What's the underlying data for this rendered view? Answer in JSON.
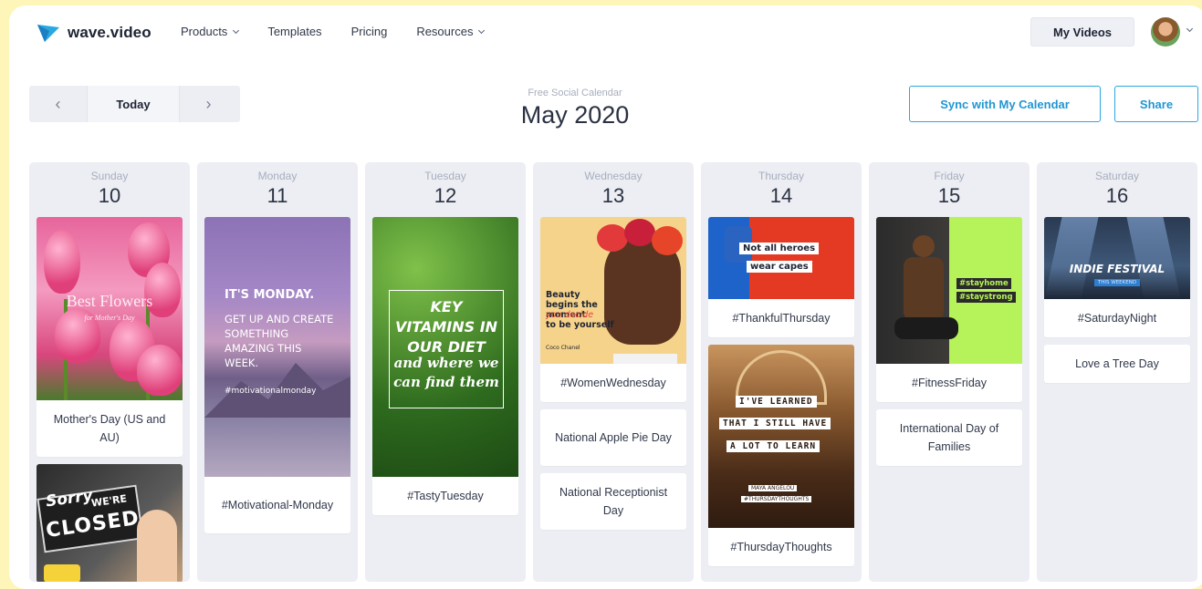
{
  "brand": {
    "name": "wave.video",
    "accent": "#2aa8e0"
  },
  "nav": {
    "products": "Products",
    "templates": "Templates",
    "pricing": "Pricing",
    "resources": "Resources",
    "my_videos": "My Videos"
  },
  "calendar": {
    "today": "Today",
    "prev_icon": "‹",
    "next_icon": "›",
    "subtitle": "Free Social Calendar",
    "title": "May 2020",
    "sync": "Sync with My Calendar",
    "share": "Share"
  },
  "days": [
    {
      "name": "Sunday",
      "num": "10"
    },
    {
      "name": "Monday",
      "num": "11"
    },
    {
      "name": "Tuesday",
      "num": "12"
    },
    {
      "name": "Wednesday",
      "num": "13"
    },
    {
      "name": "Thursday",
      "num": "14"
    },
    {
      "name": "Friday",
      "num": "15"
    },
    {
      "name": "Saturday",
      "num": "16"
    }
  ],
  "events": {
    "sun": {
      "flowers_title": "Best Flowers",
      "flowers_sub": "for Mother's Day",
      "mothers_day": "Mother's Day (US and AU)",
      "closed_1": "Sorry",
      "closed_2": "WE'RE",
      "closed_3": "CLOSED"
    },
    "mon": {
      "line1": "IT'S MONDAY.",
      "line2": "GET UP AND CREATE SOMETHING AMAZING THIS WEEK.",
      "hashtag": "#motivationalmonday",
      "caption": "#Motivational-Monday"
    },
    "tue": {
      "line1": "KEY VITAMINS IN OUR DIET",
      "line2": "and where we can find them",
      "caption": "#TastyTuesday"
    },
    "wed": {
      "quote1": "Beauty begins the moment",
      "quote2": "you decide",
      "quote3": "to be yourself",
      "author": "Coco Chanel",
      "caption1": "#WomenWednesday",
      "caption2": "National Apple Pie Day",
      "caption3": "National Receptionist Day"
    },
    "thu": {
      "heroes1": "Not all heroes",
      "heroes2": "wear capes",
      "caption1": "#ThankfulThursday",
      "lib1": "I'VE LEARNED",
      "lib2": "THAT I STILL HAVE",
      "lib3": "A LOT TO LEARN",
      "lib_author": "MAYA ANGELOU",
      "lib_tag": "#THURSDAYTHOUGHTS",
      "caption2": "#ThursdayThoughts"
    },
    "fri": {
      "tag1": "#stayhome",
      "tag2": "#staystrong",
      "caption1": "#FitnessFriday",
      "caption2": "International Day of Families"
    },
    "sat": {
      "festival": "INDIE FESTIVAL",
      "festival_sub": "THIS WEEKEND",
      "caption1": "#SaturdayNight",
      "caption2": "Love a Tree Day"
    }
  }
}
